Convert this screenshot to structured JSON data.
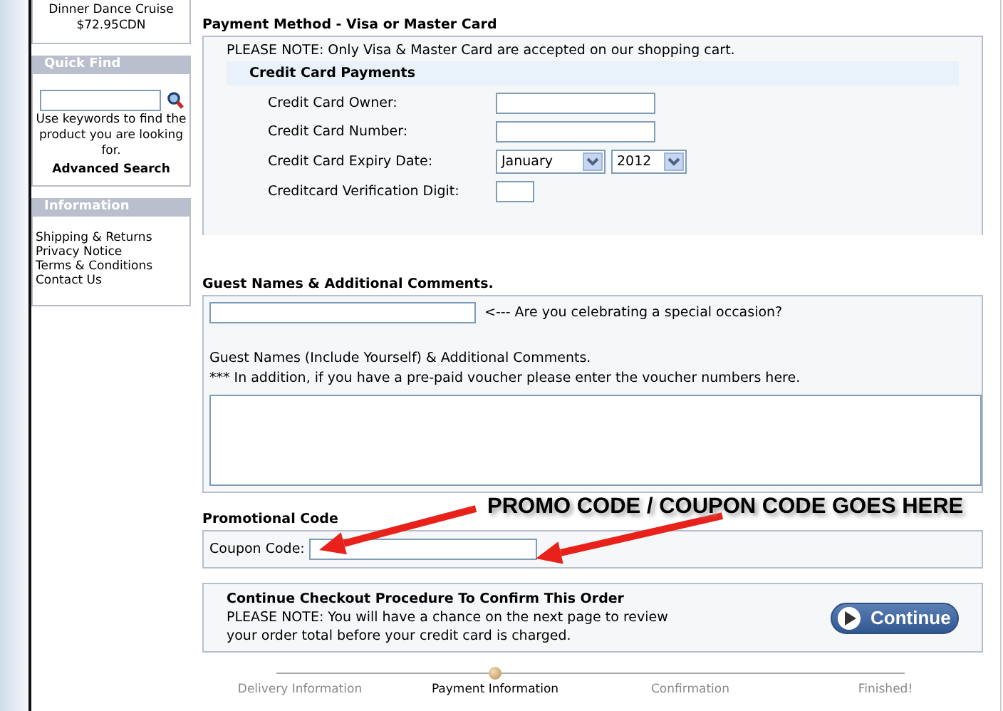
{
  "sidebar": {
    "product": {
      "name": "Dinner Dance Cruise",
      "price": "$72.95CDN"
    },
    "quick_find": {
      "title": "Quick Find",
      "hint": "Use keywords to find the product you are looking for.",
      "link": "Advanced Search"
    },
    "information": {
      "title": "Information",
      "links": [
        "Shipping & Returns",
        "Privacy Notice",
        "Terms & Conditions",
        "Contact Us"
      ]
    }
  },
  "payment": {
    "title": "Payment Method - Visa or Master Card",
    "note": "PLEASE NOTE: Only Visa & Master Card are accepted on our shopping cart.",
    "section_title": "Credit Card Payments",
    "fields": [
      {
        "label": "Credit Card Owner:",
        "kind": "text"
      },
      {
        "label": "Credit Card Number:",
        "kind": "text"
      },
      {
        "label": "Credit Card Expiry Date:",
        "kind": "date",
        "month": "January",
        "year": "2012"
      },
      {
        "label": "Creditcard Verification Digit:",
        "kind": "short"
      }
    ]
  },
  "comments": {
    "title": "Guest Names & Additional Comments.",
    "occasion_prompt": "<--- Are you celebrating a special occasion?",
    "instructions": [
      "Guest Names (Include Yourself) & Additional Comments.",
      "*** In addition, if you have a pre-paid voucher please enter the voucher numbers here."
    ]
  },
  "promo": {
    "title": "Promotional Code",
    "label": "Coupon Code:"
  },
  "continue": {
    "title": "Continue Checkout Procedure To Confirm This Order",
    "note": "PLEASE NOTE: You will have a chance on the next page to review your order total before your credit card is charged.",
    "button": "Continue"
  },
  "progress": {
    "steps": [
      {
        "label": "Delivery Information",
        "selected": false
      },
      {
        "label": "Payment Information",
        "selected": true
      },
      {
        "label": "Confirmation",
        "selected": false
      },
      {
        "label": "Finished!",
        "selected": false
      }
    ]
  },
  "annotation": {
    "text": "PROMO CODE / COUPON CODE GOES HERE"
  }
}
